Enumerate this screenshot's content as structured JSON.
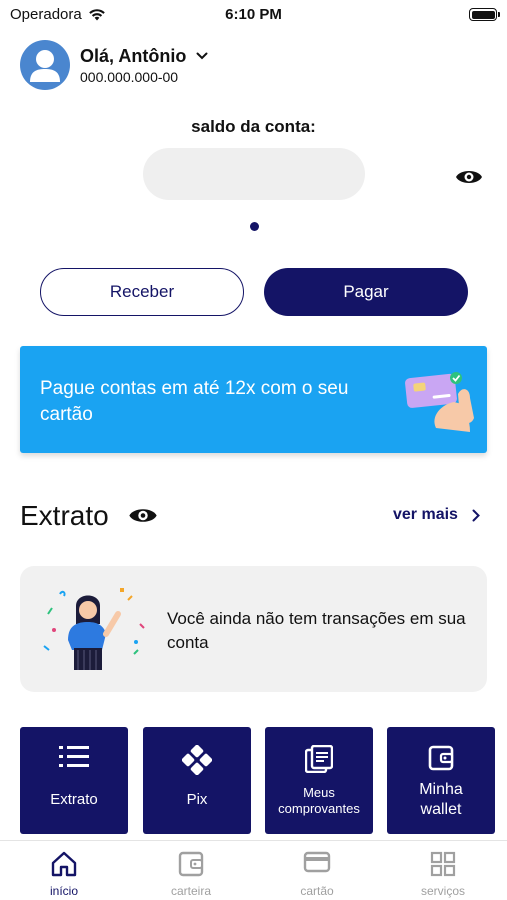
{
  "status_bar": {
    "carrier": "Operadora",
    "time": "6:10 PM"
  },
  "header": {
    "greeting": "Olá, Antônio",
    "document": "000.000.000-00"
  },
  "balance": {
    "label": "saldo da conta:"
  },
  "actions": {
    "receive_label": "Receber",
    "pay_label": "Pagar"
  },
  "promo": {
    "text": "Pague contas em até 12x com o seu cartão"
  },
  "statement": {
    "title": "Extrato",
    "see_more": "ver mais",
    "empty_message": "Você ainda não tem transações em sua conta"
  },
  "shortcuts": [
    {
      "label": "Extrato",
      "icon": "list-icon"
    },
    {
      "label": "Pix",
      "icon": "pix-icon"
    },
    {
      "label": "Meus comprovantes",
      "icon": "receipts-icon"
    },
    {
      "label": "Minha wallet",
      "icon": "wallet-icon"
    }
  ],
  "nav": [
    {
      "label": "início",
      "icon": "home-icon",
      "active": true
    },
    {
      "label": "carteira",
      "icon": "wallet-icon",
      "active": false
    },
    {
      "label": "cartão",
      "icon": "card-icon",
      "active": false
    },
    {
      "label": "serviços",
      "icon": "grid-icon",
      "active": false
    }
  ],
  "colors": {
    "primary": "#141466",
    "promo": "#1aa3f2",
    "avatar": "#4a86cf",
    "muted": "#a0a0a0"
  }
}
